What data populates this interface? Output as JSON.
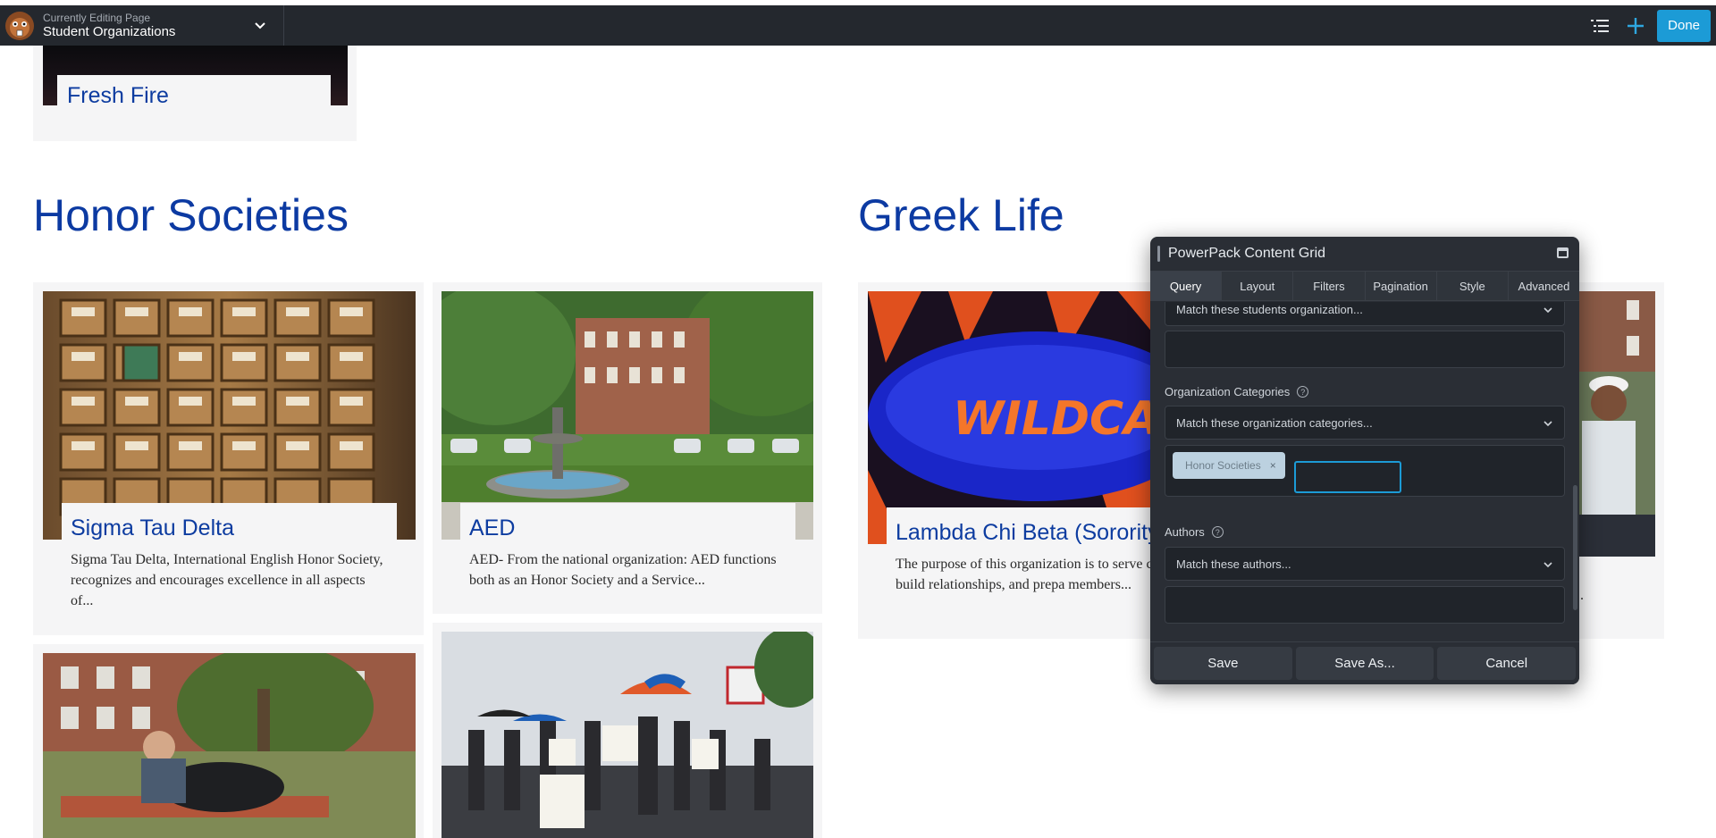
{
  "topbar": {
    "caption": "Currently Editing Page",
    "page_title": "Student Organizations",
    "done_label": "Done"
  },
  "content": {
    "top_card": {
      "title": "Fresh Fire"
    },
    "honor": {
      "heading": "Honor Societies",
      "cards": [
        {
          "title": "Sigma Tau Delta",
          "text": "Sigma Tau Delta, International English Honor Society, recognizes and encourages excellence in all aspects of..."
        },
        {
          "title": "AED",
          "text": "AED- From the national organization: AED functions both as an Honor Society and a Service..."
        }
      ]
    },
    "greek": {
      "heading": "Greek Life",
      "cards": [
        {
          "title": "Lambda Chi Beta (Sorority)",
          "text": "The purpose of this organization is to serve community, build relationships, and prepa members..."
        }
      ],
      "partial_text": "."
    },
    "image_texts": {
      "wildcats": "WILDCATS"
    }
  },
  "panel": {
    "title": "PowerPack Content Grid",
    "tabs": [
      "Query",
      "Layout",
      "Filters",
      "Pagination",
      "Style",
      "Advanced"
    ],
    "active_tab": "Query",
    "student_org_select": "Match these students organization...",
    "org_categories_label": "Organization Categories",
    "org_categories_select": "Match these organization categories...",
    "selected_chip": "Honor Societies",
    "chip_remove": "×",
    "authors_label": "Authors",
    "authors_select": "Match these authors...",
    "help_glyph": "?",
    "buttons": {
      "save": "Save",
      "save_as": "Save As...",
      "cancel": "Cancel"
    }
  }
}
